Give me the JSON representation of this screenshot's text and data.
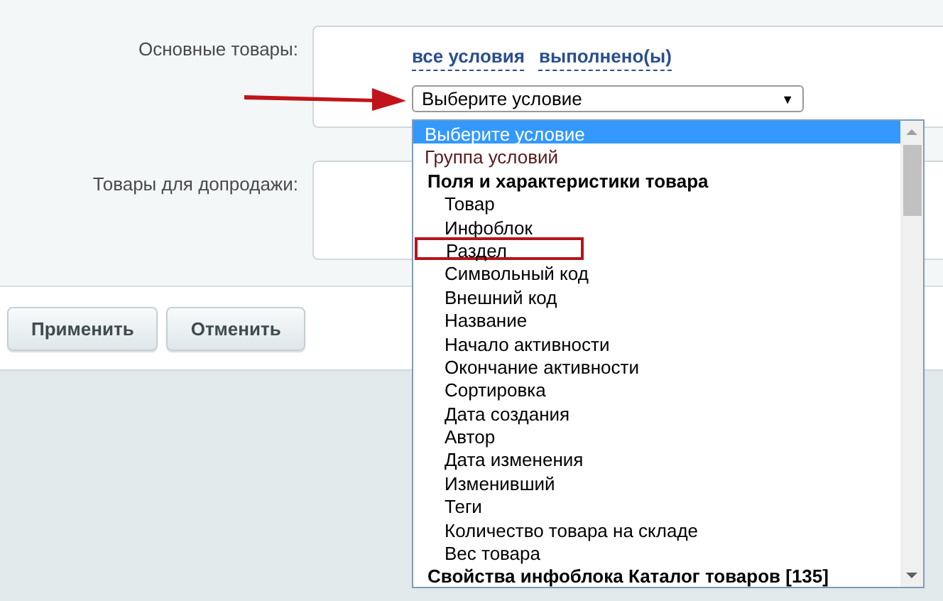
{
  "form": {
    "rows": [
      {
        "label": "Основные товары:",
        "links": [
          "все условия",
          "выполнено(ы)"
        ],
        "select": {
          "value": "Выберите условие",
          "caret": "▼"
        }
      },
      {
        "label": "Товары для допродажи:"
      }
    ]
  },
  "dropdown": {
    "options": [
      {
        "text": "Выберите условие",
        "kind": "option",
        "selected": true,
        "highlighted": false
      },
      {
        "text": "Группа условий",
        "kind": "option",
        "selected": false,
        "highlighted": false
      },
      {
        "text": "Поля и характеристики товара",
        "kind": "group",
        "selected": false,
        "highlighted": false
      },
      {
        "text": "Товар",
        "kind": "item",
        "selected": false,
        "highlighted": false
      },
      {
        "text": "Инфоблок",
        "kind": "item",
        "selected": false,
        "highlighted": false
      },
      {
        "text": "Раздел",
        "kind": "item",
        "selected": false,
        "highlighted": true
      },
      {
        "text": "Символьный код",
        "kind": "item",
        "selected": false,
        "highlighted": false
      },
      {
        "text": "Внешний код",
        "kind": "item",
        "selected": false,
        "highlighted": false
      },
      {
        "text": "Название",
        "kind": "item",
        "selected": false,
        "highlighted": false
      },
      {
        "text": "Начало активности",
        "kind": "item",
        "selected": false,
        "highlighted": false
      },
      {
        "text": "Окончание активности",
        "kind": "item",
        "selected": false,
        "highlighted": false
      },
      {
        "text": "Сортировка",
        "kind": "item",
        "selected": false,
        "highlighted": false
      },
      {
        "text": "Дата создания",
        "kind": "item",
        "selected": false,
        "highlighted": false
      },
      {
        "text": "Автор",
        "kind": "item",
        "selected": false,
        "highlighted": false
      },
      {
        "text": "Дата изменения",
        "kind": "item",
        "selected": false,
        "highlighted": false
      },
      {
        "text": "Изменивший",
        "kind": "item",
        "selected": false,
        "highlighted": false
      },
      {
        "text": "Теги",
        "kind": "item",
        "selected": false,
        "highlighted": false
      },
      {
        "text": "Количество товара на складе",
        "kind": "item",
        "selected": false,
        "highlighted": false
      },
      {
        "text": "Вес товара",
        "kind": "item",
        "selected": false,
        "highlighted": false
      },
      {
        "text": "Свойства инфоблока Каталог товаров [135]",
        "kind": "group",
        "selected": false,
        "highlighted": false
      }
    ]
  },
  "buttons": [
    "Применить",
    "Отменить"
  ]
}
